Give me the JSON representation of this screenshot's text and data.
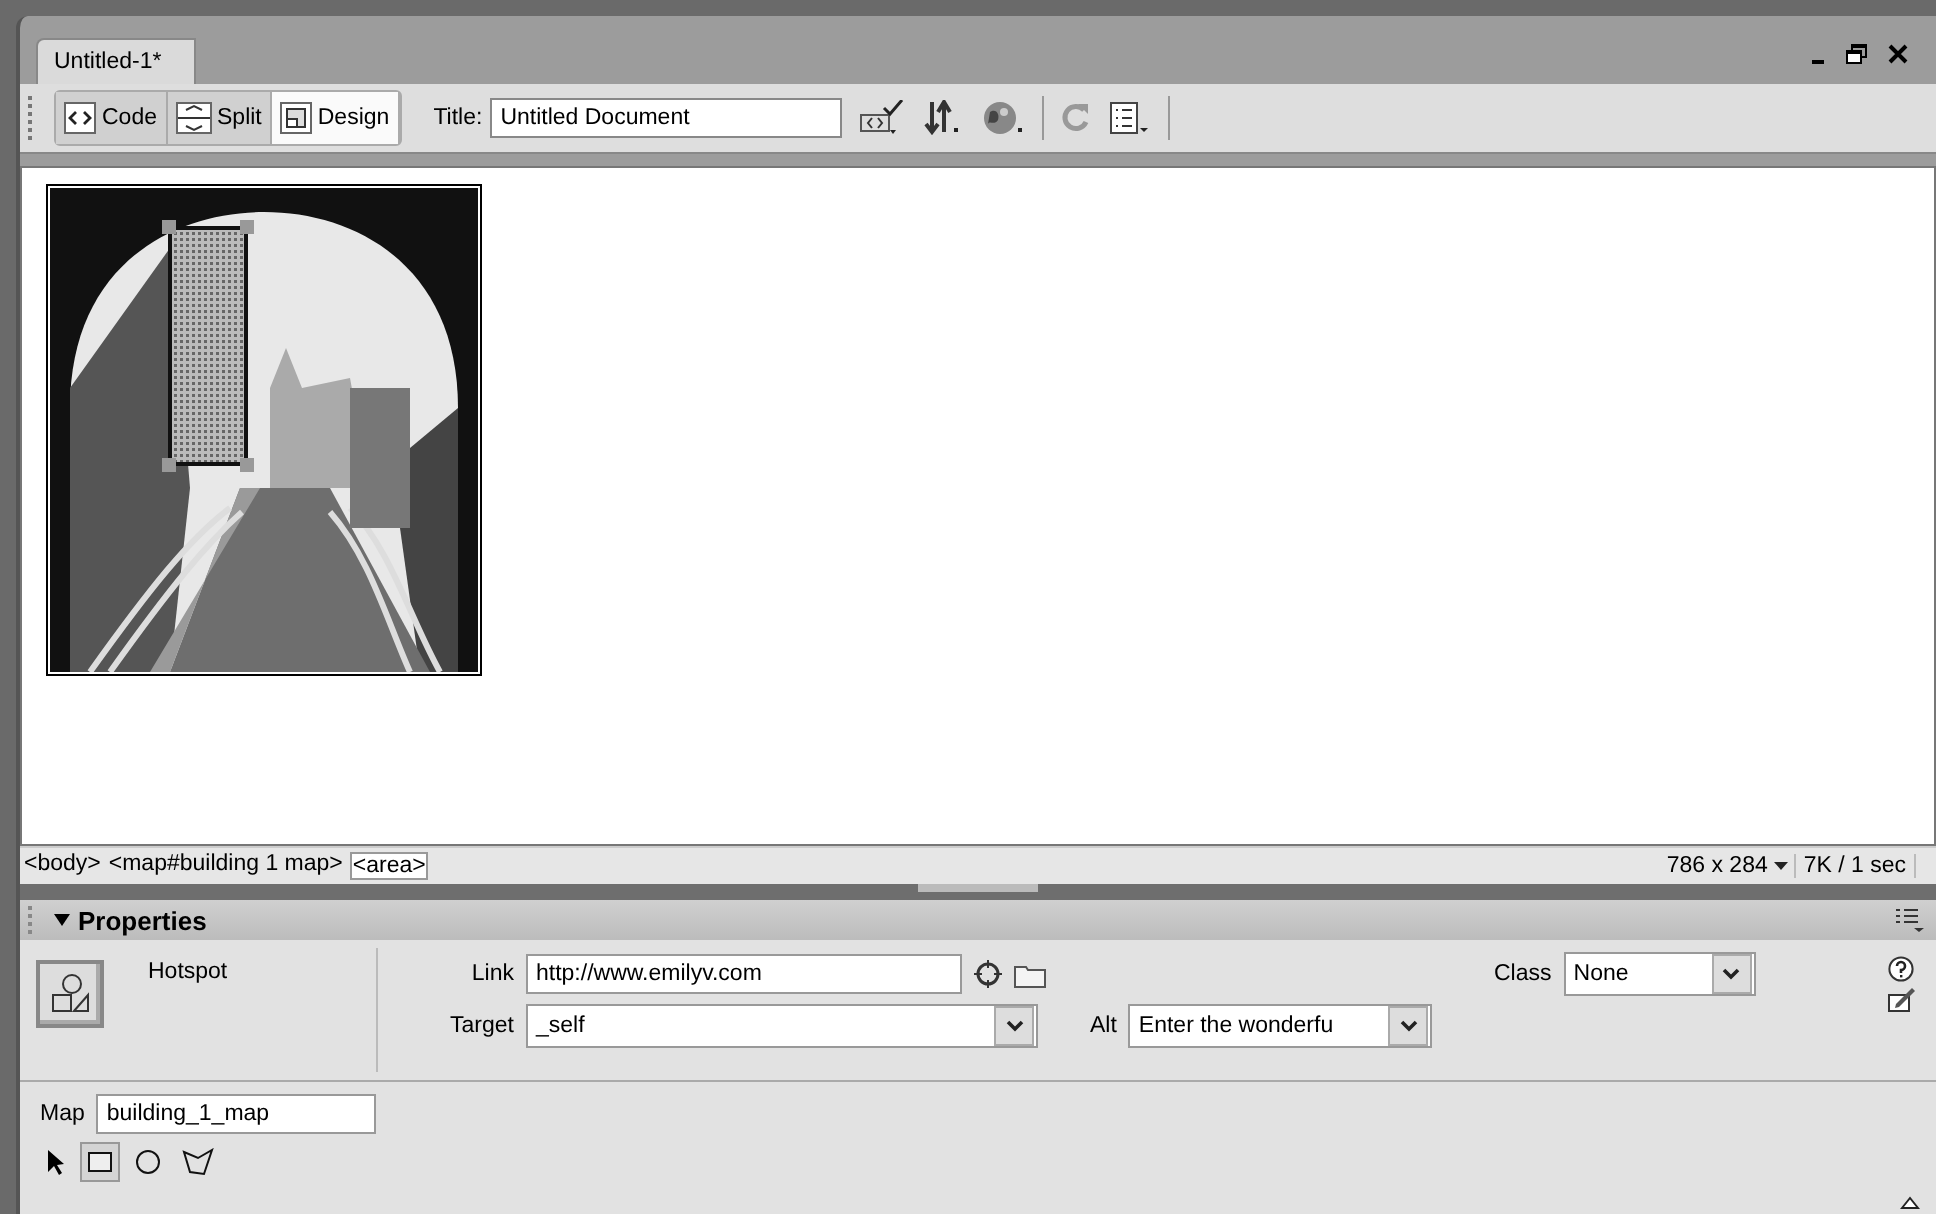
{
  "document_tab": {
    "label": "Untitled-1*"
  },
  "view_buttons": [
    {
      "kind": "code",
      "label": "Code",
      "selected": false
    },
    {
      "kind": "split",
      "label": "Split",
      "selected": false
    },
    {
      "kind": "design",
      "label": "Design",
      "selected": true
    }
  ],
  "title_field": {
    "label": "Title:",
    "value": "Untitled Document"
  },
  "document": {
    "image": {
      "kind": "picture",
      "hotspot_selected": true
    }
  },
  "tag_selector": [
    {
      "tag": "<body>",
      "selected": false
    },
    {
      "tag": "<map#building 1 map>",
      "selected": false
    },
    {
      "tag": "<area>",
      "selected": true
    }
  ],
  "status": {
    "window_size": "786 x 284",
    "download": "7K / 1 sec"
  },
  "properties": {
    "title": "Properties",
    "expanded": true,
    "element_type": "Hotspot",
    "link": {
      "label": "Link",
      "value": "http://www.emilyv.com"
    },
    "target": {
      "label": "Target",
      "value": "_self"
    },
    "class": {
      "label": "Class",
      "value": "None"
    },
    "alt": {
      "label": "Alt",
      "value": "Enter the wonderfu"
    },
    "map": {
      "label": "Map",
      "value": "building_1_map"
    },
    "tools": [
      {
        "kind": "pointer",
        "selected": false
      },
      {
        "kind": "rectangle",
        "selected": true
      },
      {
        "kind": "circle",
        "selected": false
      },
      {
        "kind": "polygon",
        "selected": false
      }
    ]
  }
}
